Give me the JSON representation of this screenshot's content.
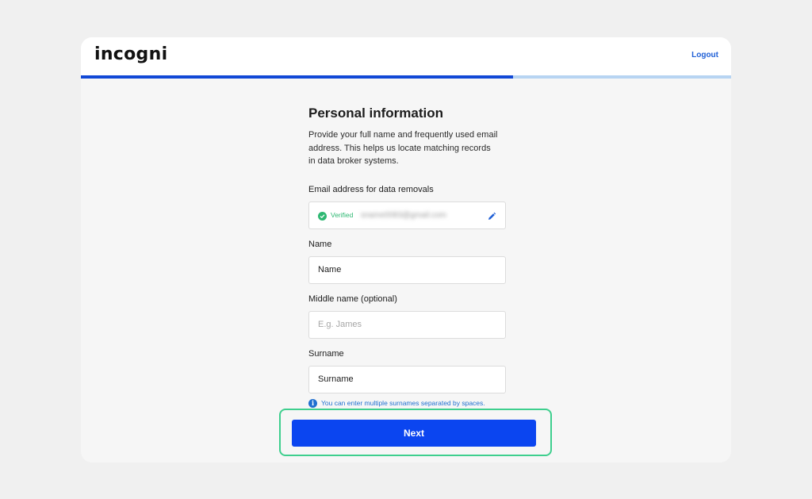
{
  "header": {
    "logo_text": "incogni",
    "logout_label": "Logout"
  },
  "progress": {
    "fraction": 0.665
  },
  "form": {
    "title": "Personal information",
    "description": "Provide your full name and frequently used email address. This helps us locate matching records in data broker systems.",
    "email": {
      "label": "Email address for data removals",
      "status": "Verified",
      "value": "sname0083@gmail.com"
    },
    "name": {
      "label": "Name",
      "placeholder": "Name"
    },
    "middle_name": {
      "label": "Middle name (optional)",
      "placeholder": "E.g. James"
    },
    "surname": {
      "label": "Surname",
      "placeholder": "Surname",
      "hint": "You can enter multiple surnames separated by spaces."
    },
    "next_label": "Next"
  },
  "colors": {
    "accent": "#0b45f0",
    "progress": "#1148d6",
    "verified": "#2eb872",
    "highlight": "#3ecf8e"
  },
  "icons": {
    "verified": "check-circle-icon",
    "edit": "pencil-icon",
    "info": "info-icon"
  }
}
